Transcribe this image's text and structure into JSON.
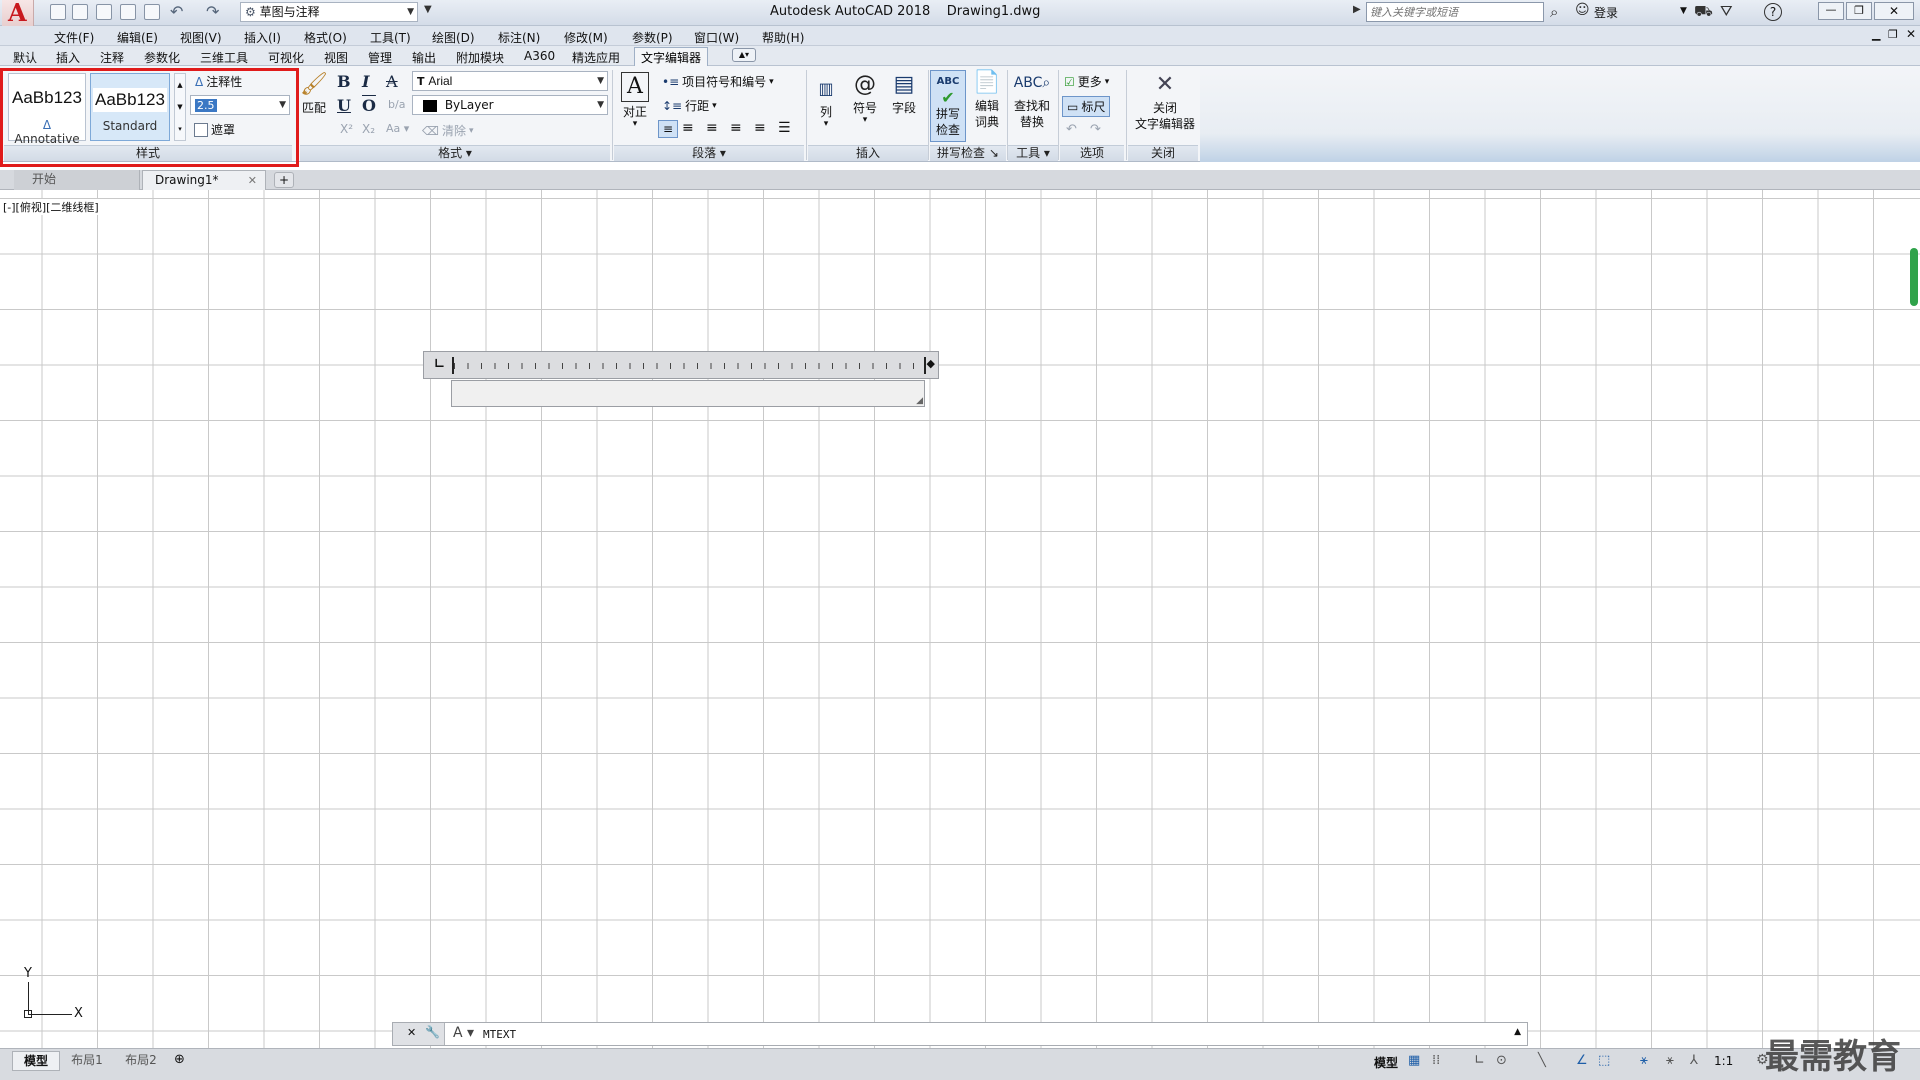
{
  "window": {
    "title": "Autodesk AutoCAD 2018",
    "filename": "Drawing1.dwg",
    "app_letter": "A"
  },
  "quick_access": {
    "workspace": "草图与注释"
  },
  "search": {
    "placeholder": "键入关键字或短语"
  },
  "account": {
    "login": "登录"
  },
  "menu": [
    "文件(F)",
    "编辑(E)",
    "视图(V)",
    "插入(I)",
    "格式(O)",
    "工具(T)",
    "绘图(D)",
    "标注(N)",
    "修改(M)",
    "参数(P)",
    "窗口(W)",
    "帮助(H)"
  ],
  "ribbon_tabs": [
    "默认",
    "插入",
    "注释",
    "参数化",
    "三维工具",
    "可视化",
    "视图",
    "管理",
    "输出",
    "附加模块",
    "A360",
    "精选应用",
    "文字编辑器"
  ],
  "ribbon_active_tab": "文字编辑器",
  "style_panel": {
    "label": "样式",
    "style1_preview": "AaBb123",
    "style1_name": "Annotative",
    "style2_preview": "AaBb123",
    "style2_name": "Standard",
    "annotative_label": "注释性",
    "height_value": "2.5",
    "mask_label": "遮罩"
  },
  "format_panel": {
    "label": "格式",
    "match_label": "匹配",
    "bold": "B",
    "italic": "I",
    "strike": "A",
    "underline": "U",
    "overline": "O",
    "font": "Arial",
    "color": "ByLayer",
    "clear_label": "清除",
    "case_label": "Aa"
  },
  "paragraph_panel": {
    "label": "段落",
    "justify_label": "对正",
    "bullets_label": "项目符号和编号",
    "linespacing_label": "行距"
  },
  "insert_panel": {
    "label": "插入",
    "columns_label": "列",
    "symbol_label": "符号",
    "field_label": "字段"
  },
  "spell_panel": {
    "label": "拼写检查",
    "spell_l1": "拼写",
    "spell_l2": "检查",
    "dict_l1": "编辑",
    "dict_l2": "词典"
  },
  "tools_panel": {
    "label": "工具",
    "find_l1": "查找和",
    "find_l2": "替换"
  },
  "options_panel": {
    "label": "选项",
    "more_label": "更多",
    "ruler_label": "标尺"
  },
  "close_panel": {
    "label": "关闭",
    "close_l1": "关闭",
    "close_l2": "文字编辑器"
  },
  "doc_tabs": {
    "start": "开始",
    "drawing": "Drawing1*",
    "add": "+"
  },
  "viewport": {
    "label": "[-][俯视][二维线框]",
    "ucs_x": "X",
    "ucs_y": "Y"
  },
  "command_line": {
    "text": "MTEXT"
  },
  "layout_tabs": [
    "模型",
    "布局1",
    "布局2"
  ],
  "status_bar": {
    "model": "模型",
    "scale": "1:1"
  },
  "watermark": "最需教育",
  "colors": {
    "accent": "#1e5ea8",
    "highlight_border": "#e01b1b",
    "grid": "#c9c9c9"
  }
}
